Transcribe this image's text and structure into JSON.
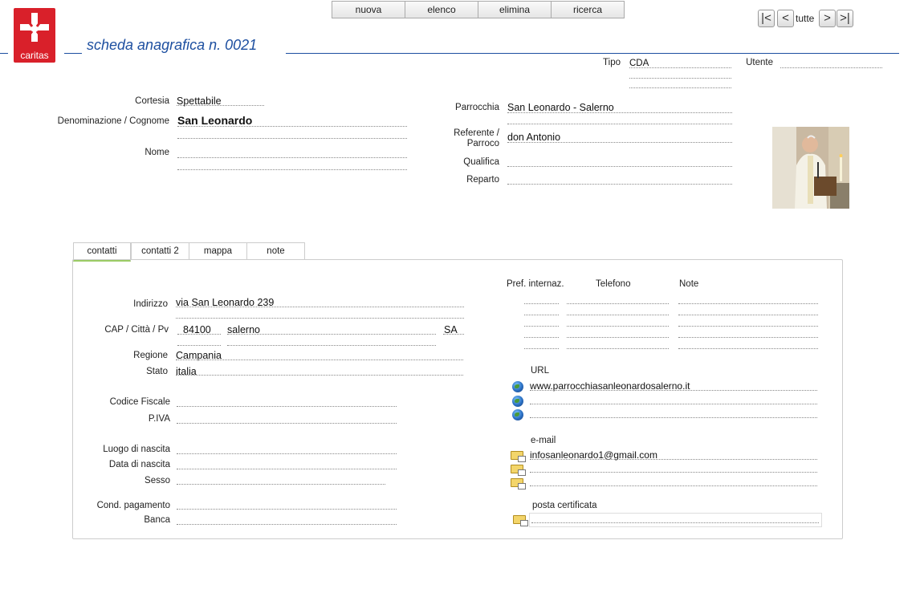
{
  "logo": {
    "text": "caritas",
    "color": "#d9202a"
  },
  "toolbar": {
    "nuova": "nuova",
    "elenco": "elenco",
    "elimina": "elimina",
    "ricerca": "ricerca"
  },
  "nav": {
    "first": "|<",
    "prev": "<",
    "all": "tutte",
    "next": ">",
    "last": ">|"
  },
  "header": {
    "title": "scheda anagrafica n. 0021",
    "prefix": "__"
  },
  "tipo": {
    "label": "Tipo",
    "value": "CDA"
  },
  "utente": {
    "label": "Utente",
    "value": ""
  },
  "cortesia": {
    "label": "Cortesia",
    "value": "Spettabile"
  },
  "denominazione": {
    "label": "Denominazione / Cognome",
    "value": "San Leonardo"
  },
  "nome": {
    "label": "Nome",
    "value": ""
  },
  "parrocchia": {
    "label": "Parrocchia",
    "value": "San Leonardo - Salerno"
  },
  "referente": {
    "label_1": "Referente /",
    "label_2": "Parroco",
    "value": "don Antonio"
  },
  "qualifica": {
    "label": "Qualifica",
    "value": ""
  },
  "reparto": {
    "label": "Reparto",
    "value": ""
  },
  "tabs": [
    {
      "label": "contatti",
      "active": true
    },
    {
      "label": "contatti 2",
      "active": false
    },
    {
      "label": "mappa",
      "active": false
    },
    {
      "label": "note",
      "active": false
    }
  ],
  "contatti": {
    "indirizzo": {
      "label": "Indirizzo",
      "value": "via San Leonardo 239"
    },
    "cap": {
      "label": "CAP / Città / Pv",
      "cap": "84100",
      "citta": "salerno",
      "pv": "SA"
    },
    "regione": {
      "label": "Regione",
      "value": "Campania"
    },
    "stato": {
      "label": "Stato",
      "value": "italia"
    },
    "codice_fiscale": {
      "label": "Codice Fiscale",
      "value": ""
    },
    "piva": {
      "label": "P.IVA",
      "value": ""
    },
    "luogo_nascita": {
      "label": "Luogo di nascita",
      "value": ""
    },
    "data_nascita": {
      "label": "Data di nascita",
      "value": ""
    },
    "sesso": {
      "label": "Sesso",
      "value": ""
    },
    "cond_pagamento": {
      "label": "Cond. pagamento",
      "value": ""
    },
    "banca": {
      "label": "Banca",
      "value": ""
    },
    "phone_headers": {
      "pref": "Pref. internaz.",
      "telefono": "Telefono",
      "note": "Note"
    },
    "url": {
      "label": "URL",
      "values": [
        "www.parrocchiasanleonardosalerno.it",
        "",
        ""
      ]
    },
    "email": {
      "label": "e-mail",
      "values": [
        "infosanleonardo1@gmail.com",
        "",
        ""
      ]
    },
    "pec": {
      "label": "posta certificata",
      "value": ""
    }
  }
}
